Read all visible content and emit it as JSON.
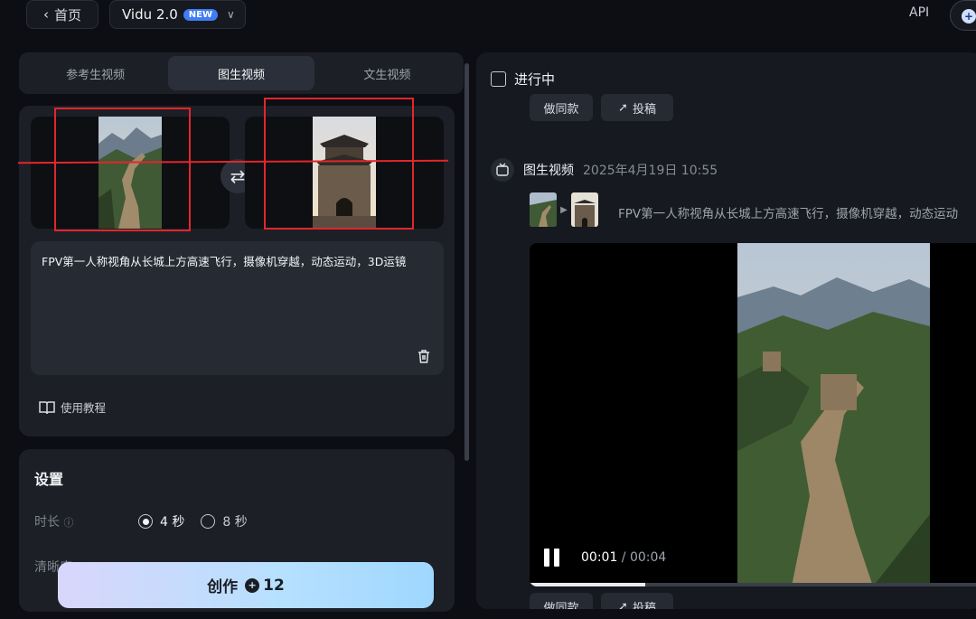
{
  "topbar": {
    "back_label": "首页",
    "model_name": "Vidu 2.0",
    "new_badge": "NEW",
    "api_label": "API"
  },
  "tabs": [
    {
      "label": "参考生视频",
      "active": false
    },
    {
      "label": "图生视频",
      "active": true
    },
    {
      "label": "文生视频",
      "active": false
    }
  ],
  "upload": {
    "prompt": "FPV第一人称视角从长城上方高速飞行，摄像机穿越，动态运动，3D运镜",
    "tutorial_label": "使用教程"
  },
  "settings": {
    "title": "设置",
    "duration_label": "时长",
    "duration_options": [
      "4 秒",
      "8 秒"
    ],
    "duration_selected": "4 秒",
    "clarity_label": "清晰度"
  },
  "create": {
    "label": "创作",
    "cost": "12"
  },
  "history": {
    "in_progress_label": "进行中",
    "chip_same": "做同款",
    "chip_submit": "投稿",
    "entry_type": "图生视频",
    "entry_time": "2025年4月19日 10:55",
    "entry_prompt": "FPV第一人称视角从长城上方高速飞行，摄像机穿越，动态运动",
    "video_current": "00:01",
    "video_separator": " / ",
    "video_total": "00:04",
    "video_progress": 0.25
  },
  "colors": {
    "accent_blue": "#3f7cf5",
    "annotation_red": "#e3262b",
    "create_gradient_start": "#d9d6fb",
    "create_gradient_end": "#9fd7ff"
  }
}
